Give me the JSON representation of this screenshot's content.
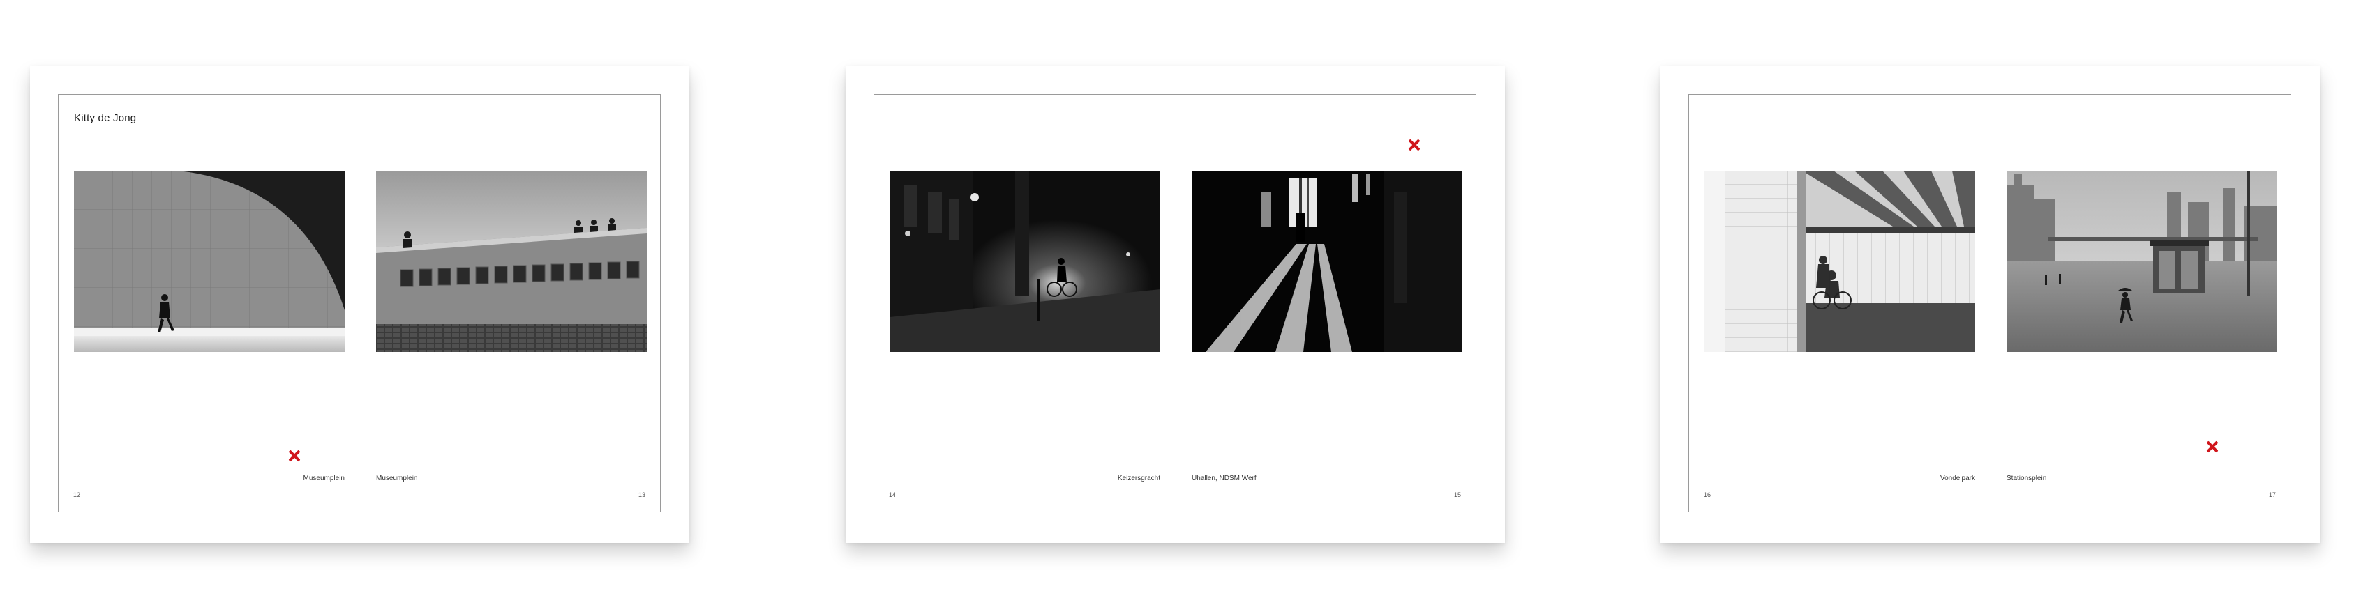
{
  "book": {
    "author": "Kitty de Jong"
  },
  "spreads": [
    {
      "left_caption": "Museumplein",
      "right_caption": "Museumplein",
      "left_page": "12",
      "right_page": "13",
      "left_photo": "woman-walking-by-curved-shadow-wall",
      "right_photo": "portrait-wall-with-people-on-top"
    },
    {
      "left_caption": "Keizersgracht",
      "right_caption": "Uhallen, NDSM Werf",
      "left_page": "14",
      "right_page": "15",
      "left_photo": "night-street-with-cyclist",
      "right_photo": "backlit-hall-with-light-beams"
    },
    {
      "left_caption": "Vondelpark",
      "right_caption": "Stationsplein",
      "left_page": "16",
      "right_page": "17",
      "left_photo": "cyclist-under-striped-ceiling",
      "right_photo": "rainy-square-with-umbrella"
    }
  ],
  "icons": {
    "marker": "x-mark-icon",
    "marker_color": "#d0161c"
  }
}
